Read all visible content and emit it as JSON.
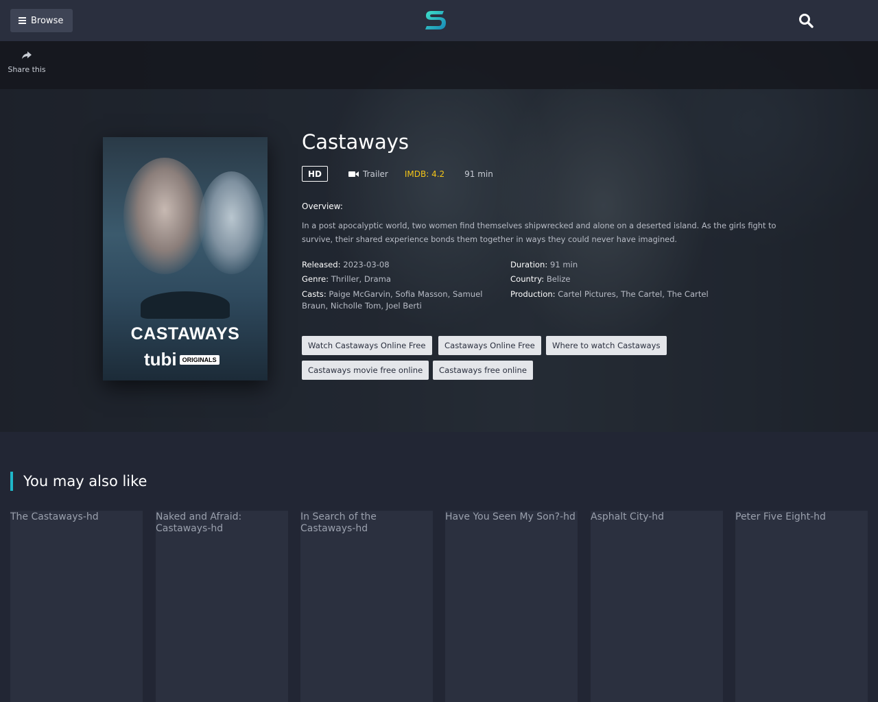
{
  "header": {
    "browse_label": "Browse",
    "logo_icon": "s-logo-icon",
    "search_icon": "search-icon"
  },
  "share": {
    "label": "Share this",
    "icon": "share-icon"
  },
  "movie": {
    "poster_title": "CASTAWAYS",
    "poster_brand": "tubi",
    "poster_badge": "ORIGINALS",
    "title": "Castaways",
    "quality": "HD",
    "trailer_label": "Trailer",
    "imdb": "IMDB: 4.2",
    "duration_short": "91 min",
    "overview_heading": "Overview:",
    "overview": "In a post apocalyptic world, two women find themselves shipwrecked and alone on a deserted island. As the girls fight to survive, their shared experience bonds them together in ways they could never have imagined.",
    "released_label": "Released:",
    "released": "2023-03-08",
    "genre_label": "Genre:",
    "genre": "Thriller, Drama",
    "casts_label": "Casts:",
    "casts": "Paige McGarvin, Sofia Masson, Samuel Braun, Nicholle Tom, Joel Berti",
    "duration_label": "Duration:",
    "duration": "91 min",
    "country_label": "Country:",
    "country": "Belize",
    "production_label": "Production:",
    "production": "Cartel Pictures, The Cartel, The Cartel",
    "tags": [
      "Watch Castaways Online Free",
      "Castaways Online Free",
      "Where to watch Castaways",
      "Castaways movie free online",
      "Castaways free online"
    ]
  },
  "related": {
    "heading": "You may also like",
    "items": [
      "The Castaways-hd",
      "Naked and Afraid: Castaways-hd",
      "In Search of the Castaways-hd",
      "Have You Seen My Son?-hd",
      "Asphalt City-hd",
      "Peter Five Eight-hd"
    ]
  },
  "colors": {
    "accent": "#1fb7c9",
    "imdb": "#f5c518",
    "background": "#222634",
    "header": "#2a2f3e"
  }
}
